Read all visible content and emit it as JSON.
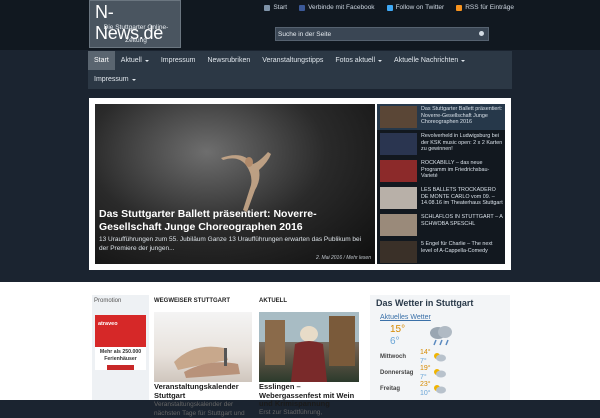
{
  "header": {
    "logo_title": "N-News.de",
    "logo_subtitle": "Die Stuttgarter Online-Zeitung",
    "top_links": [
      {
        "label": "Start",
        "icon": "home-icon"
      },
      {
        "label": "Verbinde mit Facebook",
        "icon": "facebook-icon"
      },
      {
        "label": "Follow on Twitter",
        "icon": "twitter-icon"
      },
      {
        "label": "RSS für Einträge",
        "icon": "rss-icon"
      }
    ],
    "search_placeholder": "Suche in der Seite"
  },
  "nav": {
    "items": [
      {
        "label": "Start",
        "active": true,
        "dropdown": false
      },
      {
        "label": "Aktuell",
        "dropdown": true
      },
      {
        "label": "Impressum",
        "dropdown": false
      },
      {
        "label": "Newsrubriken",
        "dropdown": false
      },
      {
        "label": "Veranstaltungstipps",
        "dropdown": false
      },
      {
        "label": "Fotos aktuell",
        "dropdown": true
      },
      {
        "label": "Aktuelle Nachrichten",
        "dropdown": true
      },
      {
        "label": "Impressum",
        "dropdown": true
      }
    ]
  },
  "slider": {
    "title": "Das Stuttgarter Ballett präsentiert: Noverre-Gesellschaft Junge Choreographen 2016",
    "text": "13 Uraufführungen zum 55. Jubiläum Ganze 13 Uraufführungen erwarten das Publikum bei der Premiere der jungen...",
    "meta": "2. Mai 2016 / Mehr lesen",
    "thumbs": [
      {
        "title": "Das Stuttgarter Ballett präsentiert: Noverre-Gesellschaft Junge Choreographen 2016"
      },
      {
        "title": "Revolverheld in Ludwigsburg bei der KSK music open: 2 x 2 Karten zu gewinnen!"
      },
      {
        "title": "ROCKABILLY – das neue Programm im Friedrichsbau-Varieté"
      },
      {
        "title": "LES BALLETS TROCKADERO DE MONTE CARLO vom 09. – 14.08.16 im Theaterhaus Stuttgart"
      },
      {
        "title": "SCHLAFLOS IN STUTTGART – A SCHWOBA SPESCHL"
      },
      {
        "title": "5 Engel für Charlie – The next level of A-Cappella-Comedy"
      }
    ]
  },
  "promotion": {
    "heading": "Promotion",
    "brand": "atraveo",
    "line1": "Mehr als 250.000",
    "line2": "Ferienhäuser"
  },
  "wegweiser": {
    "heading": "WEGWEISER STUTTGART",
    "title": "Veranstaltungskalender Stuttgart",
    "text": "Veranstaltungskalender der nächsten Tage für Stuttgart und"
  },
  "aktuell": {
    "heading": "AKTUELL",
    "title": "Esslingen – Webergassenfest mit Wein und Krimispannung",
    "text": "Erst zur Stadtführung,"
  },
  "weather": {
    "heading": "Das Wetter in Stuttgart",
    "link": "Aktuelles Wetter",
    "now_high": "15°",
    "now_low": "6°",
    "days": [
      {
        "day": "Mittwoch",
        "high": "14°",
        "low": "7°"
      },
      {
        "day": "Donnerstag",
        "high": "19°",
        "low": "7°"
      },
      {
        "day": "Freitag",
        "high": "23°",
        "low": "10°"
      }
    ]
  },
  "colors": {
    "background": "#1b2430",
    "nav": "#2c3845",
    "accent_orange": "#d68a00",
    "accent_blue": "#6aa5d6",
    "promo_red": "#d62828"
  }
}
